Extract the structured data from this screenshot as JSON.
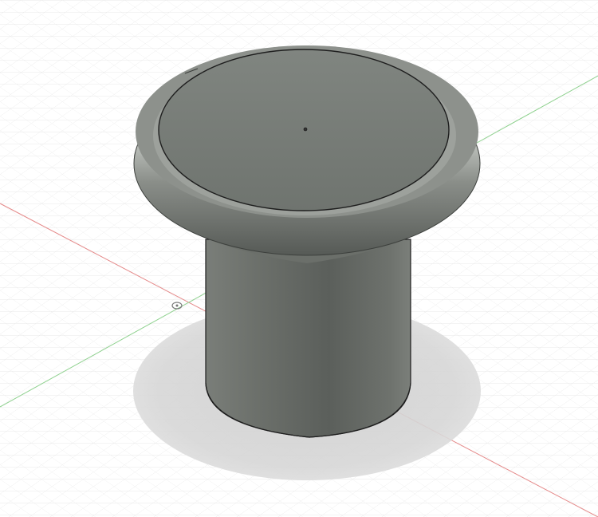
{
  "viewport": {
    "background": "#ffffff",
    "grid_minor_color": "#e6e6e6",
    "grid_major_color": "#cfcfcf",
    "axis_x_color": "#e58a8a",
    "axis_z_color": "#8fd18f"
  },
  "model": {
    "shape": "knob",
    "body_color": "#707470",
    "cap_color": "#7a7f79",
    "shadow_color": "#d4d4d4",
    "edge_color": "#1e1e1e"
  },
  "origin_marker": {
    "icon": "origin-icon"
  }
}
